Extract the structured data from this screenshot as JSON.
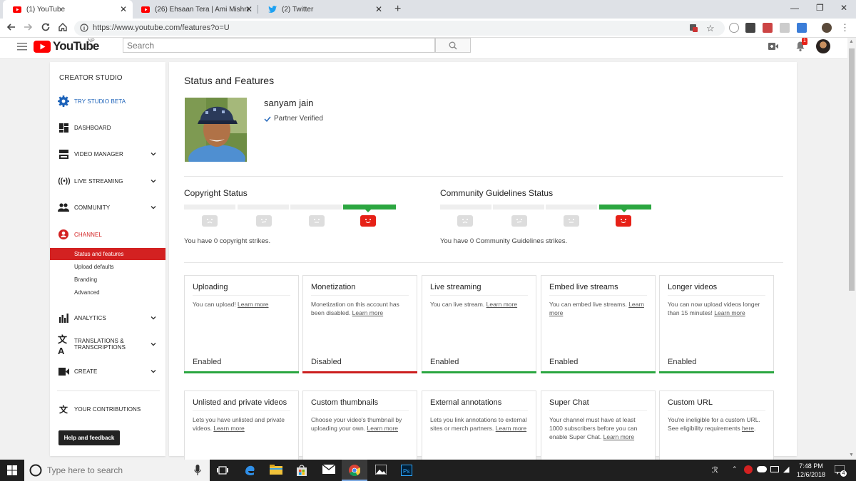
{
  "browser": {
    "tabs": [
      {
        "label": "(1) YouTube"
      },
      {
        "label": "(26) Ehsaan Tera | Ami Mishra Ft."
      },
      {
        "label": "(2) Twitter"
      }
    ],
    "url": "https://www.youtube.com/features?o=U"
  },
  "header": {
    "logo_text": "YouTube",
    "region": "NP",
    "search_placeholder": "Search",
    "notification_count": "1"
  },
  "sidebar": {
    "title": "CREATOR STUDIO",
    "items": [
      {
        "label": "TRY STUDIO BETA"
      },
      {
        "label": "DASHBOARD"
      },
      {
        "label": "VIDEO MANAGER"
      },
      {
        "label": "LIVE STREAMING"
      },
      {
        "label": "COMMUNITY"
      },
      {
        "label": "CHANNEL"
      },
      {
        "label": "ANALYTICS"
      },
      {
        "label": "TRANSLATIONS &"
      },
      {
        "label": "CREATE"
      },
      {
        "label": "YOUR CONTRIBUTIONS"
      }
    ],
    "translations_line2": "TRANSCRIPTIONS",
    "channel_sub": [
      {
        "label": "Status and features"
      },
      {
        "label": "Upload defaults"
      },
      {
        "label": "Branding"
      },
      {
        "label": "Advanced"
      }
    ],
    "help_label": "Help and feedback"
  },
  "main": {
    "title": "Status and Features",
    "user_name": "sanyam jain",
    "verified": "Partner Verified",
    "copyright": {
      "title": "Copyright Status",
      "text": "You have 0 copyright strikes."
    },
    "community": {
      "title": "Community Guidelines Status",
      "text": "You have 0 Community Guidelines strikes."
    },
    "cards": [
      {
        "title": "Uploading",
        "desc": "You can upload!",
        "link": "Learn more",
        "status": "Enabled",
        "state_color": "#2ba640"
      },
      {
        "title": "Monetization",
        "desc": "Monetization on this account has been disabled.",
        "link": "Learn more",
        "status": "Disabled",
        "state_color": "#cc1f1f"
      },
      {
        "title": "Live streaming",
        "desc": "You can live stream.",
        "link": "Learn more",
        "status": "Enabled",
        "state_color": "#2ba640"
      },
      {
        "title": "Embed live streams",
        "desc": "You can embed live streams.",
        "link": "Learn more",
        "status": "Enabled",
        "state_color": "#2ba640"
      },
      {
        "title": "Longer videos",
        "desc": "You can now upload videos longer than 15 minutes!",
        "link": "Learn more",
        "status": "Enabled",
        "state_color": "#2ba640"
      },
      {
        "title": "Unlisted and private videos",
        "desc": "Lets you have unlisted and private videos.",
        "link": "Learn more"
      },
      {
        "title": "Custom thumbnails",
        "desc": "Choose your video's thumbnail by uploading your own.",
        "link": "Learn more"
      },
      {
        "title": "External annotations",
        "desc": "Lets you link annotations to external sites or merch partners.",
        "link": "Learn more"
      },
      {
        "title": "Super Chat",
        "desc": "Your channel must have at least 1000 subscribers before you can enable Super Chat.",
        "link": "Learn more"
      },
      {
        "title": "Custom URL",
        "desc": "You're ineligible for a custom URL. See eligibility requirements",
        "link": "here",
        "suffix": "."
      }
    ]
  },
  "taskbar": {
    "search_placeholder": "Type here to search",
    "time": "7:48 PM",
    "date": "12/6/2018",
    "notifications": "4"
  },
  "colors": {
    "yt_red": "#ff0000",
    "accent_red": "#d32121",
    "enabled_green": "#2ba640",
    "studio_blue": "#1c62b9"
  }
}
